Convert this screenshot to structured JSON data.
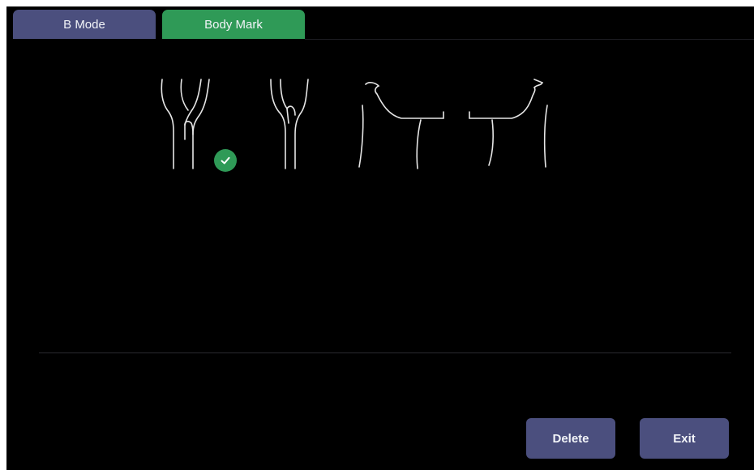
{
  "tabs": [
    {
      "label": "B Mode",
      "active": false
    },
    {
      "label": "Body Mark",
      "active": true
    }
  ],
  "body_marks": [
    {
      "icon": "carotid-bifurcation-left-icon",
      "selected": true
    },
    {
      "icon": "carotid-bifurcation-right-icon",
      "selected": false
    },
    {
      "icon": "neck-thyroid-left-icon",
      "selected": false
    },
    {
      "icon": "neck-thyroid-right-icon",
      "selected": false
    }
  ],
  "selected_indicator": {
    "icon": "check-icon"
  },
  "buttons": {
    "delete_label": "Delete",
    "exit_label": "Exit"
  },
  "colors": {
    "inactive_tab": "#4b4f7e",
    "active_tab": "#2f9a57",
    "button": "#4b4f7e",
    "check_badge": "#2f9a57",
    "background": "#000000",
    "outline": "#e6e6e6"
  }
}
